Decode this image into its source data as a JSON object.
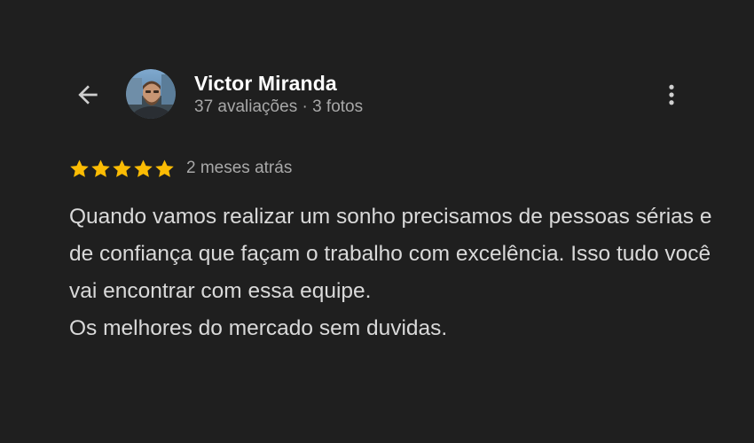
{
  "header": {
    "back_icon": "arrow-back-icon",
    "more_icon": "more-vert-icon"
  },
  "author": {
    "name": "Victor Miranda",
    "meta": "37 avaliações · 3 fotos",
    "avatar_icon": "user-avatar-photo"
  },
  "review": {
    "rating": 5,
    "rating_max": 5,
    "star_color": "#fbbc04",
    "date": "2 meses atrás",
    "paragraph1": "Quando vamos realizar um sonho precisamos de pessoas sérias e de confiança que façam o trabalho com excelência. Isso tudo você vai encontrar com essa equipe.",
    "paragraph2": "Os melhores do mercado sem duvidas."
  },
  "colors": {
    "background": "#1f1f1f",
    "accent_star": "#fbbc04"
  }
}
